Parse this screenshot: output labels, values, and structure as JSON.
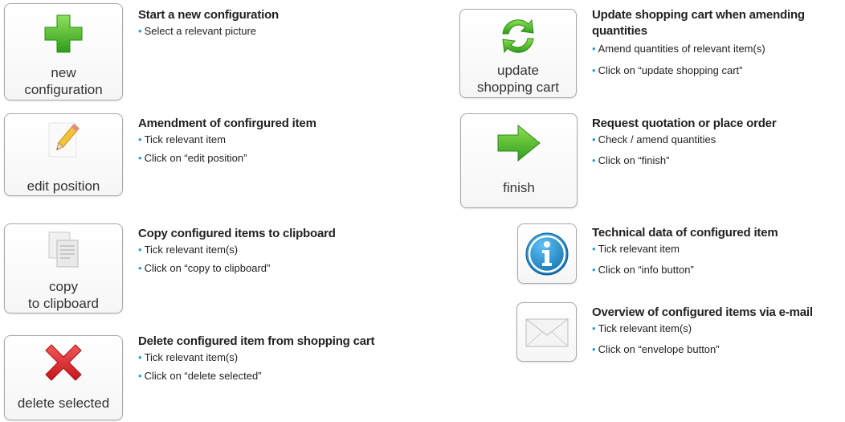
{
  "left_column": [
    {
      "button_label": "new\nconfiguration",
      "icon": "green-plus-icon",
      "title": "Start a new configuration",
      "steps": [
        "Select a relevant picture"
      ]
    },
    {
      "button_label": "edit position",
      "icon": "pencil-note-icon",
      "title": "Amendment of confirgured item",
      "steps": [
        "Tick relevant item",
        "Click on “edit position”"
      ]
    },
    {
      "button_label": "copy\nto clipboard",
      "icon": "copy-documents-icon",
      "title": "Copy configured items to clipboard",
      "steps": [
        "Tick relevant item(s)",
        "Click on “copy to clipboard”"
      ]
    },
    {
      "button_label": "delete selected",
      "icon": "red-x-icon",
      "title": "Delete configured item from shopping cart",
      "steps": [
        "Tick relevant item(s)",
        "Click on “delete selected”"
      ]
    }
  ],
  "right_column": [
    {
      "button_label": "update\nshopping cart",
      "icon": "refresh-arrows-icon",
      "title": "Update shopping cart when amending quantities",
      "steps": [
        "Amend quantities of relevant item(s)",
        "Click on “update shopping cart”"
      ]
    },
    {
      "button_label": "finish",
      "icon": "green-arrow-right-icon",
      "title": "Request quotation or place order",
      "steps": [
        "Check / amend quantities",
        "Click on “finish”"
      ]
    },
    {
      "icon": "info-icon",
      "title": "Technical data of configured item",
      "steps": [
        "Tick relevant item",
        "Click on “info button”"
      ]
    },
    {
      "icon": "envelope-icon",
      "title": "Overview of configured items via e-mail",
      "steps": [
        "Tick relevant item(s)",
        "Click on “envelope button”"
      ]
    }
  ],
  "colors": {
    "bullet": "#2a9bd7",
    "plus_green": "#4fbf2a",
    "delete_red": "#d9262a",
    "info_blue": "#1a85c8"
  }
}
